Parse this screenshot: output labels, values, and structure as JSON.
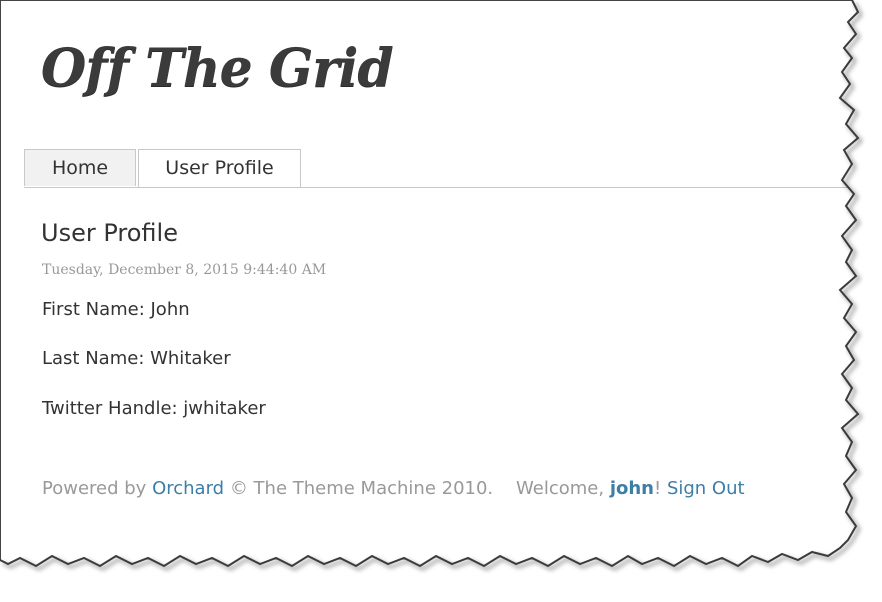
{
  "site": {
    "title": "Off The Grid"
  },
  "nav": {
    "tabs": [
      {
        "label": "Home",
        "active": false
      },
      {
        "label": "User Profile",
        "active": true
      }
    ]
  },
  "main": {
    "heading": "User Profile",
    "timestamp": "Tuesday, December 8, 2015 9:44:40 AM",
    "fields": {
      "first_name": "First Name: John",
      "last_name": "Last Name: Whitaker",
      "twitter": "Twitter Handle: jwhitaker"
    }
  },
  "footer": {
    "powered_by": "Powered by ",
    "orchard_link": "Orchard",
    "copyright": " © The Theme Machine 2010.",
    "welcome_prefix": "Welcome, ",
    "username": "john",
    "welcome_suffix": "! ",
    "sign_out": "Sign Out"
  },
  "colors": {
    "link": "#3d7ea6",
    "muted_text": "#999999",
    "body_text": "#333333",
    "title_text": "#3b3b3b"
  }
}
